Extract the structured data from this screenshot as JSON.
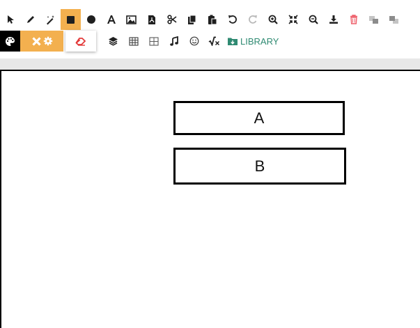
{
  "toolbar": {
    "library_label": "LIBRARY"
  },
  "canvas": {
    "shapes": [
      {
        "label": "A"
      },
      {
        "label": "B"
      }
    ]
  },
  "colors": {
    "accent": "#f3b04f",
    "library": "#2f8a72",
    "delete": "#ee5f6a"
  }
}
